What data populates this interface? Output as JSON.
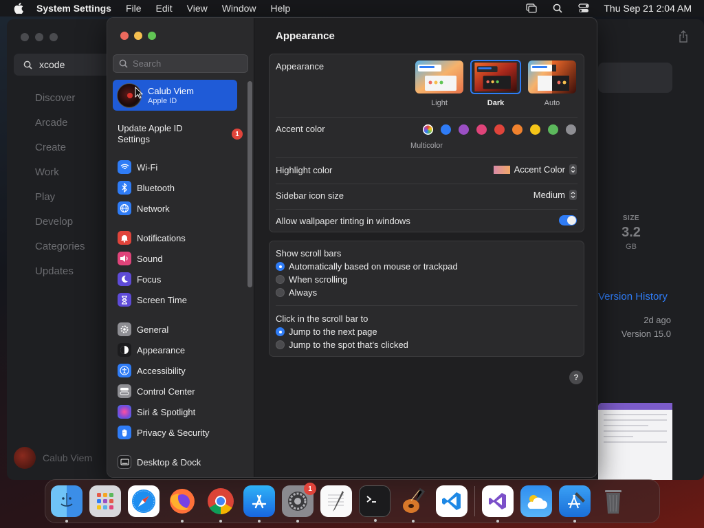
{
  "menubar": {
    "app_name": "System Settings",
    "menus": [
      "File",
      "Edit",
      "View",
      "Window",
      "Help"
    ],
    "clock": "Thu Sep 21  2:04 AM"
  },
  "appstore": {
    "search_value": "xcode",
    "nav": [
      "Discover",
      "Arcade",
      "Create",
      "Work",
      "Play",
      "Develop",
      "Categories",
      "Updates"
    ],
    "user_name": "Calub Viem",
    "size_label": "SIZE",
    "size_value": "3.2",
    "size_unit": "GB",
    "version_history": "Version History",
    "updated_ago": "2d ago",
    "version": "Version 15.0"
  },
  "sidebar": {
    "search_placeholder": "Search",
    "account_name": "Calub Viem",
    "account_sub": "Apple ID",
    "update_label": "Update Apple ID Settings",
    "update_badge": "1",
    "group1": [
      {
        "label": "Wi-Fi",
        "icon": "wifi-icon",
        "color": "#2f7cf6"
      },
      {
        "label": "Bluetooth",
        "icon": "bluetooth-icon",
        "color": "#2f7cf6"
      },
      {
        "label": "Network",
        "icon": "globe-icon",
        "color": "#2f7cf6"
      }
    ],
    "group2": [
      {
        "label": "Notifications",
        "icon": "bell-icon",
        "color": "#e0443b"
      },
      {
        "label": "Sound",
        "icon": "speaker-icon",
        "color": "#e0447a"
      },
      {
        "label": "Focus",
        "icon": "moon-icon",
        "color": "#5e4bd8"
      },
      {
        "label": "Screen Time",
        "icon": "hourglass-icon",
        "color": "#5e4bd8"
      }
    ],
    "group3": [
      {
        "label": "General",
        "icon": "gear-icon",
        "color": "#8e8e93"
      },
      {
        "label": "Appearance",
        "icon": "appearance-icon",
        "color": "#1c1c1e"
      },
      {
        "label": "Accessibility",
        "icon": "accessibility-icon",
        "color": "#2f7cf6"
      },
      {
        "label": "Control Center",
        "icon": "toggles-icon",
        "color": "#8e8e93"
      },
      {
        "label": "Siri & Spotlight",
        "icon": "siri-icon",
        "color": "#7a4bd8"
      },
      {
        "label": "Privacy & Security",
        "icon": "hand-icon",
        "color": "#2f7cf6"
      }
    ],
    "group4": [
      {
        "label": "Desktop & Dock",
        "icon": "dock-icon",
        "color": "#1c1c1e"
      }
    ]
  },
  "pane": {
    "title": "Appearance",
    "appearance_label": "Appearance",
    "appearance_options": [
      {
        "label": "Light",
        "selected": false
      },
      {
        "label": "Dark",
        "selected": true
      },
      {
        "label": "Auto",
        "selected": false
      }
    ],
    "accent_label": "Accent color",
    "accent_colors": [
      "multicolor",
      "#2f7cf6",
      "#9b4fc4",
      "#e0447a",
      "#e0443b",
      "#f0822e",
      "#f5c518",
      "#5cb85c",
      "#8e8e93"
    ],
    "accent_selected_caption": "Multicolor",
    "highlight_label": "Highlight color",
    "highlight_value": "Accent Color",
    "sidebar_icon_label": "Sidebar icon size",
    "sidebar_icon_value": "Medium",
    "wallpaper_tint_label": "Allow wallpaper tinting in windows",
    "wallpaper_tint_on": true,
    "scrollbars_label": "Show scroll bars",
    "scrollbar_options": [
      {
        "label": "Automatically based on mouse or trackpad",
        "selected": true
      },
      {
        "label": "When scrolling",
        "selected": false
      },
      {
        "label": "Always",
        "selected": false
      }
    ],
    "click_label": "Click in the scroll bar to",
    "click_options": [
      {
        "label": "Jump to the next page",
        "selected": true
      },
      {
        "label": "Jump to the spot that’s clicked",
        "selected": false
      }
    ],
    "help": "?"
  },
  "dock": {
    "apps": [
      "finder-icon",
      "launchpad-icon",
      "safari-icon",
      "firefox-icon",
      "chrome-icon",
      "app-store-icon",
      "system-settings-icon",
      "textedit-icon",
      "terminal-icon",
      "garageband-icon",
      "vscode-icon",
      "visual-studio-icon",
      "weather-icon",
      "xcode-icon",
      "trash-icon"
    ],
    "settings_badge": "1"
  }
}
